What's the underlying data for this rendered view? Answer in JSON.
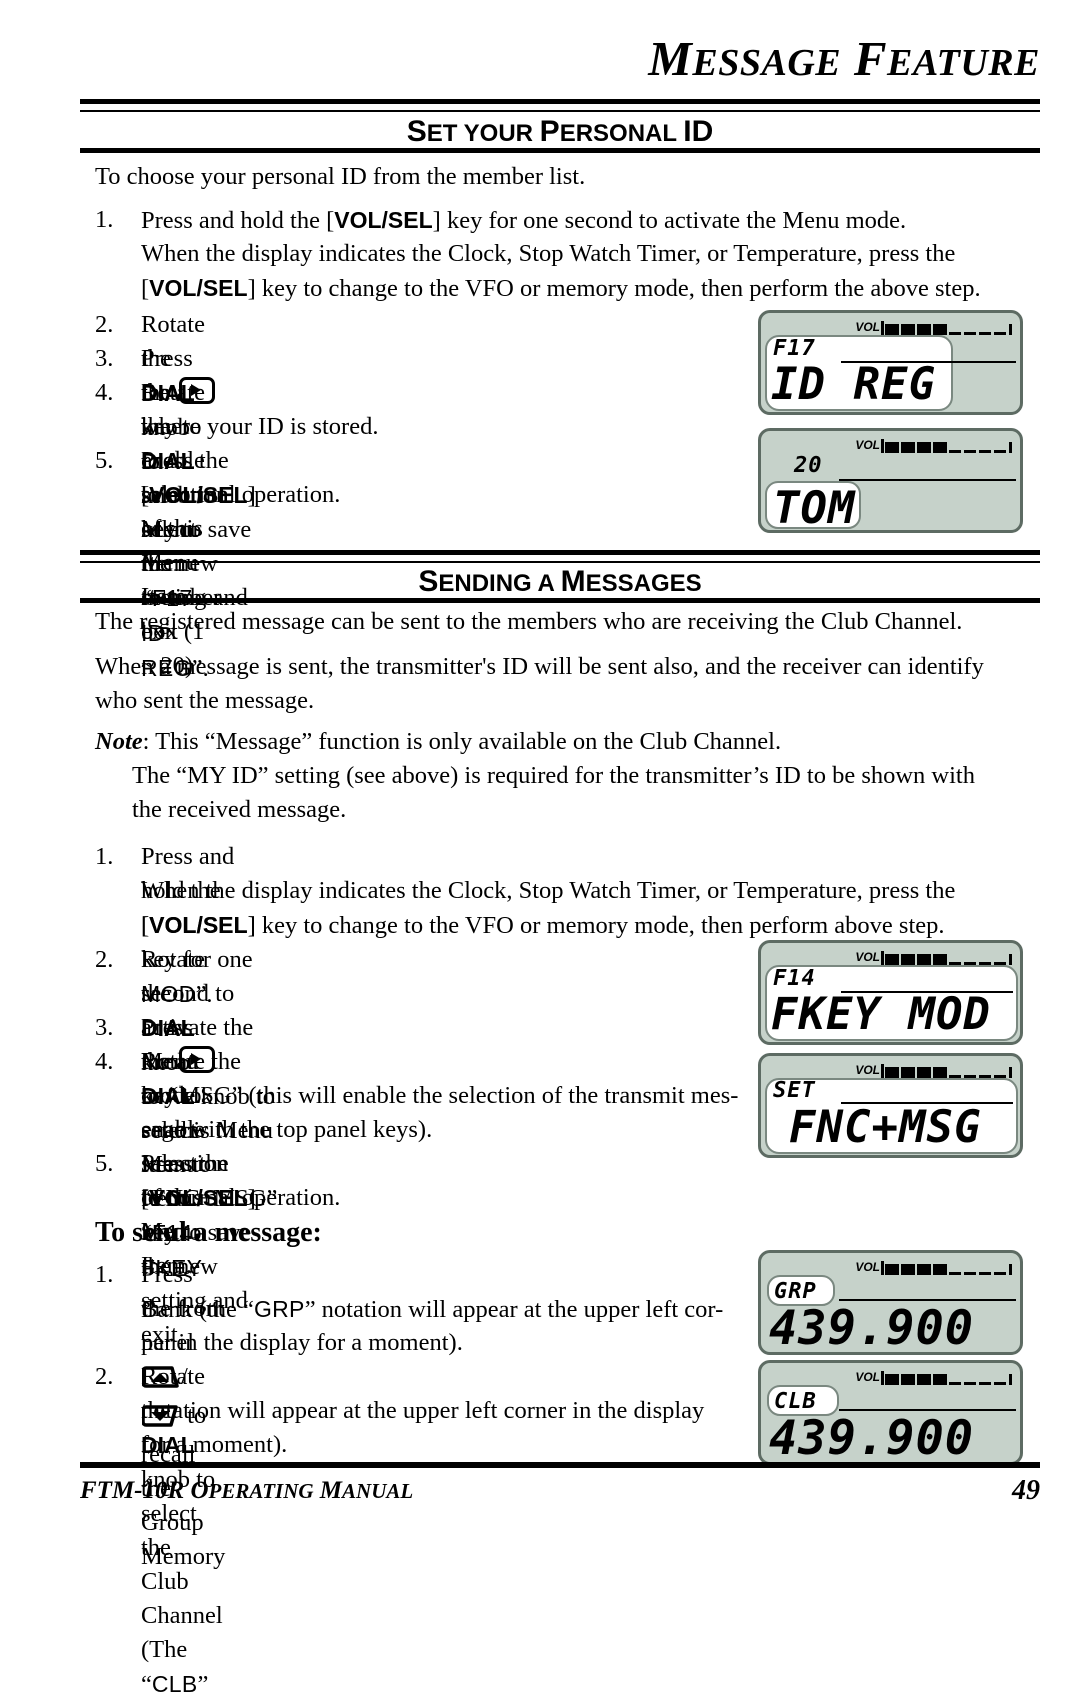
{
  "chapter": {
    "title_word1_cap": "M",
    "title_word1_rest": "ESSAGE",
    "title_word2_cap": "F",
    "title_word2_rest": "EATURE"
  },
  "sections": [
    {
      "heading_parts": [
        "S",
        "ET YOUR ",
        "P",
        "ERSONAL ",
        "ID"
      ],
      "heading_plain": "SET YOUR PERSONAL ID",
      "intro": "To choose your personal ID from the member list.",
      "steps": [
        {
          "num": "1.",
          "lines": [
            "Press and hold the [VOL/SEL] key for one second to activate the Menu mode.",
            "When the display indicates the Clock, Stop Watch Timer, or Temperature, press the",
            "[VOL/SEL] key to change to the VFO or memory mode, then perform the above step."
          ]
        },
        {
          "num": "2.",
          "lines": [
            "Rotate the DIAL knob to select Menu Item “F17 ID REG”."
          ]
        },
        {
          "num": "3.",
          "lines": [
            "Press the [▶] key to enable selection of this Menu Item."
          ]
        },
        {
          "num": "4.",
          "lines": [
            "Rotate the DIAL knob to select the member box (1 ~ 20)",
            "where your ID is stored."
          ]
        },
        {
          "num": "5.",
          "lines": [
            "Press the [VOL/SEL] key to save the new setting and exit",
            "to normal operation."
          ]
        }
      ]
    },
    {
      "heading_parts": [
        "S",
        "ENDING A ",
        "M",
        "ESSAGES"
      ],
      "heading_plain": "SENDING A MESSAGES",
      "paragraphs": [
        "The registered message can be sent to the members who are receiving the Club Channel.",
        "When a message is sent, the transmitter's ID will be sent also, and the receiver can identify",
        "who sent the message."
      ],
      "note": {
        "label": "Note",
        "line1": ": This “Message” function is only available on the Club Channel.",
        "line2": "The “MY ID” setting (see above) is required for the transmitter’s ID to be shown with",
        "line3": "the received message."
      },
      "steps": [
        {
          "num": "1.",
          "lines": [
            "Press and hold the [VOL/SEL] key for one second to activate the Menu mode.",
            "When the display indicates the Clock, Stop Watch Timer, or Temperature, press the",
            "[VOL/SEL] key to change to the VFO or memory mode, then perform above step."
          ]
        },
        {
          "num": "2.",
          "lines": [
            "Rotate the DIAL knob to select Menu Item “F14 FKEY",
            "MOD”."
          ]
        },
        {
          "num": "3.",
          "lines": [
            "Press the [▶] key to enable selection of this Menu Item."
          ]
        },
        {
          "num": "4.",
          "lines": [
            "Rotate the DIAL knob to set this Menu Item to “FNC+MSG”",
            "or “MSG” (this will enable the selection of the transmit mes-",
            "sage with the top panel keys)."
          ]
        },
        {
          "num": "5.",
          "lines": [
            "Press the [VOL/SEL] key to save the new setting and exit",
            "to normal operation."
          ]
        }
      ],
      "subheading": "To send a message:",
      "send_steps": [
        {
          "num": "1.",
          "lines": [
            "Press the front panel [▲]/[▼] to recall the Group Memory",
            "Bank (the “GRP” notation will appear at the upper left cor-",
            "ner in the display for a moment)."
          ]
        },
        {
          "num": "2.",
          "lines": [
            "Rotate the DIAL knob to select the Club Channel (The “CLB”",
            "notation will appear at the upper left corner in the display",
            "for a moment)."
          ]
        }
      ]
    }
  ],
  "text_fragments": {
    "s1_1a_pre": "Press and hold the [",
    "s1_1a_key": "VOL/SEL",
    "s1_1a_post": "] key for one second to activate the Menu mode.",
    "s1_1b": "When the display indicates the Clock, Stop Watch Timer, or Temperature, press the",
    "s1_1c_pre": "[",
    "s1_1c_key": "VOL/SEL",
    "s1_1c_post": "] key to change to the VFO or memory mode, then perform the above step.",
    "s1_2_pre": "Rotate the ",
    "s1_2_dial": "DIAL",
    "s1_2_mid": " knob to select Menu Item “",
    "s1_2_item": "F17 ID REG",
    "s1_2_post": "”.",
    "s1_3_pre": "Press the ",
    "s1_3_post": " key to enable selection of this Menu Item.",
    "s1_4_pre": "Rotate the ",
    "s1_4_dial": "DIAL",
    "s1_4_post": " knob to select the member box (1 ~ 20)",
    "s1_4b": "where your ID is stored.",
    "s1_5_pre": "Press the [",
    "s1_5_key": "VOL/SEL",
    "s1_5_post": "] key to save the new setting and exit",
    "s1_5b": "to normal operation.",
    "s2_1a_post": "] key for one second to activate the Menu mode.",
    "s2_1c_post": "] key to change to the VFO or memory mode, then perform above step.",
    "s2_2_mid": " knob to select Menu Item “",
    "s2_2_item": "F14 FKEY",
    "s2_2b_item": "MOD",
    "s2_2b_post": "”.",
    "s2_4_mid": " knob to set this Menu Item to “",
    "s2_4_val1": "FNC+MSG",
    "s2_4_post": "”",
    "s2_4b_pre": "or “",
    "s2_4b_val": "MSG",
    "s2_4b_post": "” (this will enable the selection of the transmit mes-",
    "s2_4c": "sage with the top panel keys).",
    "s3_1_pre": "Press the front panel ",
    "s3_1_post": " to recall the Group Memory",
    "s3_1b_pre": "Bank (the “",
    "s3_1b_val": "GRP",
    "s3_1b_post": "” notation will appear at the upper left cor-",
    "s3_1c": "ner in the display for a moment).",
    "s3_2_pre": "Rotate the ",
    "s3_2_dial": "DIAL",
    "s3_2_mid": " knob to select the Club Channel (The “",
    "s3_2_val": "CLB",
    "s3_2_post": "”",
    "s3_2b": "notation will appear at the upper left corner in the display",
    "s3_2c": "for a moment)."
  },
  "lcd_displays": [
    {
      "id": "lcd-f17-id-reg",
      "vol_label": "VOL",
      "vol_filled": 4,
      "vol_empty": 4,
      "small": "F17",
      "big": "ID REG",
      "style": "menu"
    },
    {
      "id": "lcd-20-tom",
      "vol_label": "VOL",
      "vol_filled": 4,
      "vol_empty": 4,
      "small": "20",
      "big": "TOM",
      "style": "pill"
    },
    {
      "id": "lcd-f14-fkey-mod",
      "vol_label": "VOL",
      "vol_filled": 4,
      "vol_empty": 4,
      "small": "F14",
      "big": "FKEY MOD",
      "style": "menu"
    },
    {
      "id": "lcd-set-fnc-msg",
      "vol_label": "VOL",
      "vol_filled": 4,
      "vol_empty": 4,
      "small": "SET",
      "big": "FNC+MSG",
      "style": "menu"
    },
    {
      "id": "lcd-grp-439900",
      "vol_label": "VOL",
      "vol_filled": 4,
      "vol_empty": 4,
      "small": "GRP",
      "big": "439.900",
      "style": "pill"
    },
    {
      "id": "lcd-clb-439900",
      "vol_label": "VOL",
      "vol_filled": 4,
      "vol_empty": 4,
      "small": "CLB",
      "big": "439.900",
      "style": "pill"
    }
  ],
  "footer": {
    "model": "FTM-10R",
    "operating_cap": "O",
    "operating_rest": "PERATING",
    "manual_cap": "M",
    "manual_rest": "ANUAL",
    "page_number": "49"
  },
  "colors": {
    "lcd_bg": "#c6d2ca",
    "lcd_border": "#5d6b63",
    "lcd_field": "#ffffff",
    "ink": "#000000",
    "paper": "#ffffff"
  }
}
